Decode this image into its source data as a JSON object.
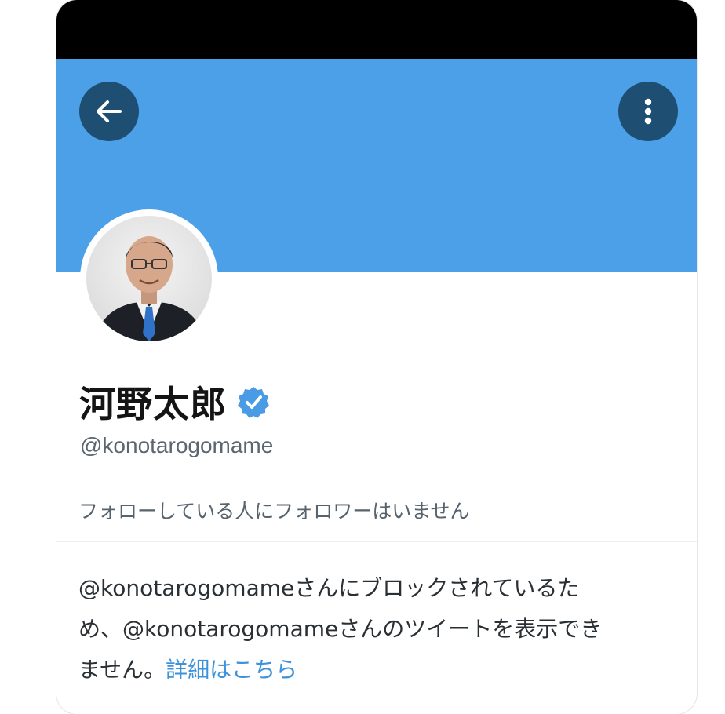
{
  "profile": {
    "display_name": "河野太郎",
    "handle": "@konotarogomame",
    "follow_note": "フォローしている人にフォロワーはいません"
  },
  "block_notice": {
    "line1": "@konotarogomameさんにブロックされているた",
    "line2": "め、@konotarogomameさんのツイートを表示でき",
    "line3": "ません。",
    "link_label": "詳細はこちら"
  },
  "icons": {
    "back": "arrow-left-icon",
    "more": "vertical-dots-icon",
    "verified": "verified-badge-icon"
  },
  "colors": {
    "banner": "#4ca0e8",
    "button_bg": "#1f4e73",
    "link": "#3d92dc",
    "verified": "#4a9be5"
  }
}
